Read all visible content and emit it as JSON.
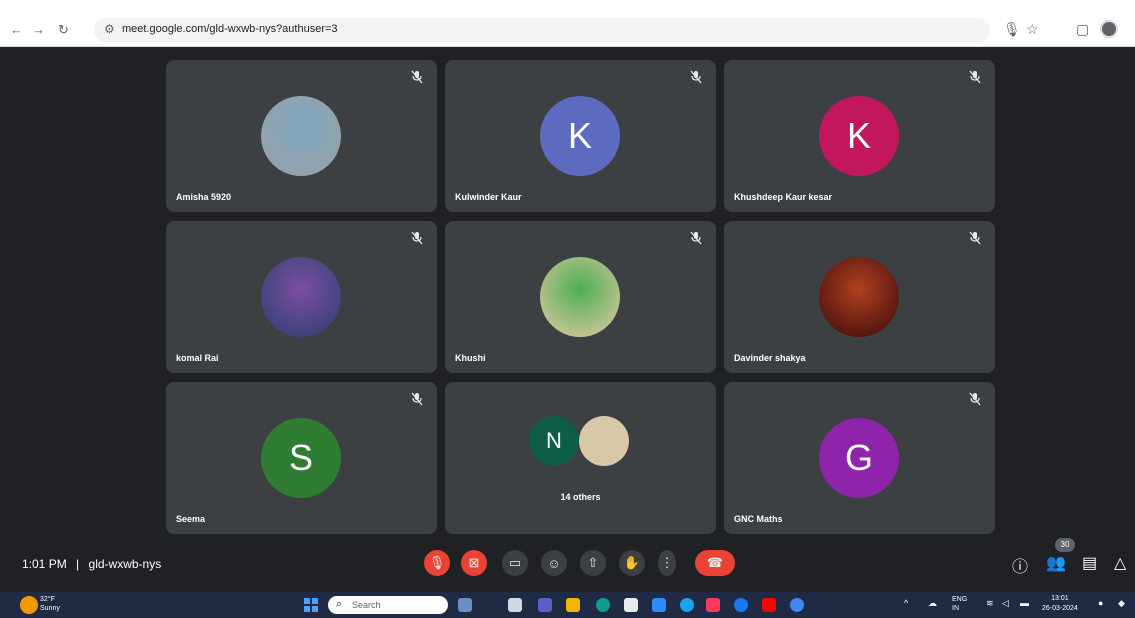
{
  "browser": {
    "url": "meet.google.com/gld-wxwb-nys?authuser=3",
    "back": "←",
    "forward": "→",
    "reload": "↻",
    "site_info": "⚙",
    "icons": [
      "mic-icon",
      "star-icon",
      "extension-icon",
      "profile-icon"
    ]
  },
  "participants": [
    {
      "name": "Amisha 5920",
      "type": "photo",
      "colors": [
        "#9aa0a6",
        "#7fa7c0"
      ]
    },
    {
      "name": "Kulwinder Kaur",
      "type": "initial",
      "initial": "K",
      "color": "#5c6bc0"
    },
    {
      "name": "Khushdeep Kaur kesar",
      "type": "initial",
      "initial": "K",
      "color": "#c2185b"
    },
    {
      "name": "komal Rai",
      "type": "photo",
      "colors": [
        "#2c3e70",
        "#7b4fa0"
      ]
    },
    {
      "name": "Khushi",
      "type": "photo",
      "colors": [
        "#e6c9a8",
        "#4caf50"
      ]
    },
    {
      "name": "Davinder shakya",
      "type": "photo",
      "colors": [
        "#3a0a0a",
        "#b04020"
      ]
    },
    {
      "name": "Seema",
      "type": "initial",
      "initial": "S",
      "color": "#2e7d32"
    },
    {
      "name": "",
      "type": "group",
      "initial": "N",
      "color": "#0d5d48",
      "others_label": "14 others"
    },
    {
      "name": "GNC Maths",
      "type": "initial",
      "initial": "G",
      "color": "#8e24aa"
    }
  ],
  "meeting": {
    "time": "1:01 PM",
    "separator": "|",
    "code": "gld-wxwb-nys",
    "people_count": "30"
  },
  "controls": [
    {
      "name": "mic-off-button",
      "glyph": "🎙",
      "style": "red"
    },
    {
      "name": "camera-off-button",
      "glyph": "⊠",
      "style": "red"
    },
    {
      "name": "captions-button",
      "glyph": "▭",
      "style": ""
    },
    {
      "name": "emoji-button",
      "glyph": "☺",
      "style": ""
    },
    {
      "name": "present-button",
      "glyph": "⇧",
      "style": ""
    },
    {
      "name": "raise-hand-button",
      "glyph": "✋",
      "style": ""
    },
    {
      "name": "more-options-button",
      "glyph": "⋮",
      "style": "more"
    },
    {
      "name": "leave-call-button",
      "glyph": "☎",
      "style": "end"
    }
  ],
  "right_controls": [
    "ⓘ",
    "👥",
    "▤",
    "△"
  ],
  "taskbar": {
    "weather_temp": "32°F",
    "weather_text": "Sunny",
    "search_placeholder": "Search",
    "tray_lang": "ENG",
    "tray_region": "IN",
    "clock_time": "13:01",
    "clock_date": "26-03-2024"
  }
}
